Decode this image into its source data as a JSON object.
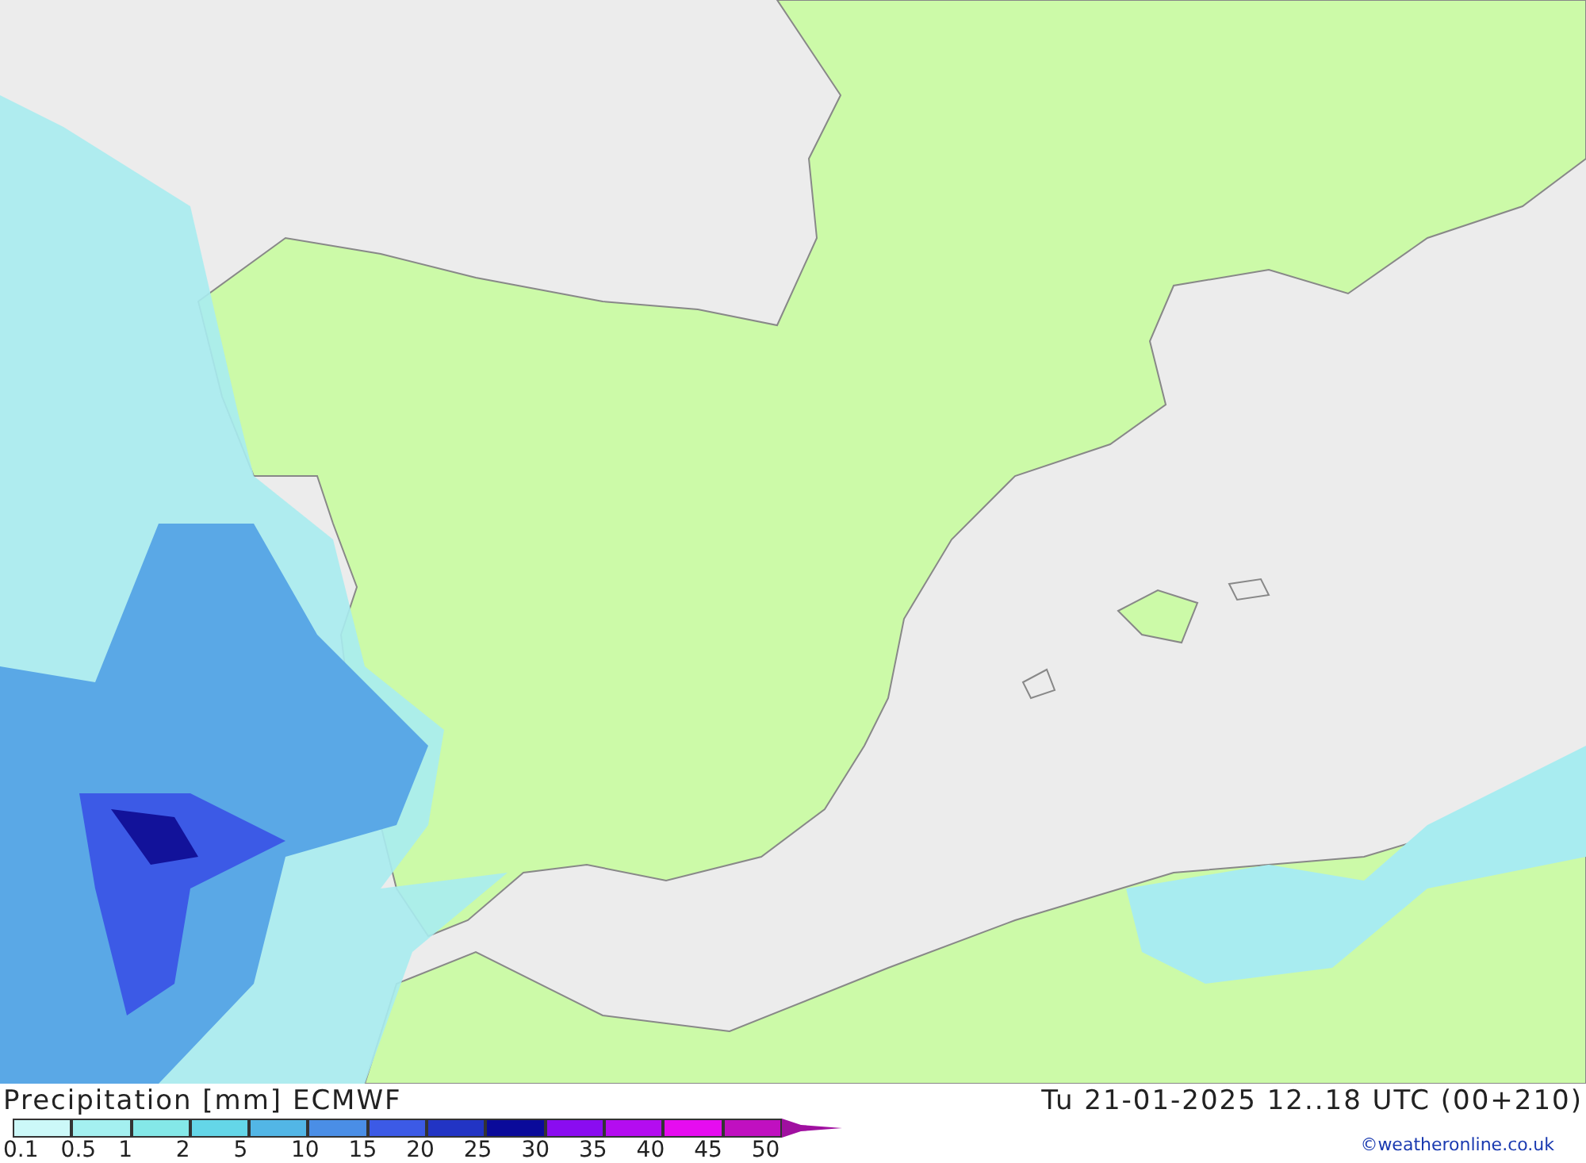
{
  "map": {
    "title": "Precipitation [mm] ECMWF",
    "valid_time": "Tu 21-01-2025 12..18 UTC (00+210)"
  },
  "legend": {
    "bins": [
      {
        "color": "#ccf8f8"
      },
      {
        "color": "#a4f0f0"
      },
      {
        "color": "#84e8e8"
      },
      {
        "color": "#64d6e8"
      },
      {
        "color": "#52b6e6"
      },
      {
        "color": "#4a8ee6"
      },
      {
        "color": "#3c5ae6"
      },
      {
        "color": "#2234c4"
      },
      {
        "color": "#0a0a9a"
      },
      {
        "color": "#8a0cf0"
      },
      {
        "color": "#b40cf0"
      },
      {
        "color": "#e60cf0"
      },
      {
        "color": "#c010c0"
      }
    ],
    "labels": [
      "0.1",
      "0.5",
      "1",
      "2",
      "5",
      "10",
      "15",
      "20",
      "25",
      "30",
      "35",
      "40",
      "45",
      "50"
    ]
  },
  "credit": "©weatheronline.co.uk"
}
